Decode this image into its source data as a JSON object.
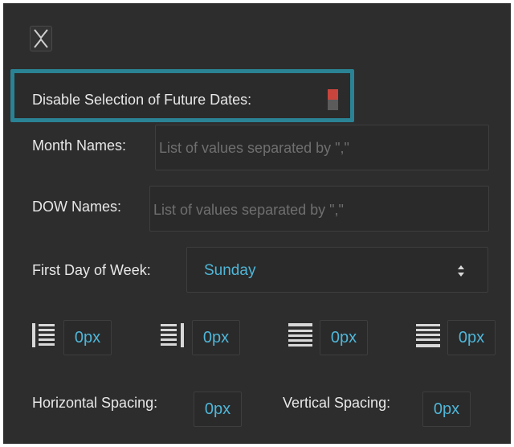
{
  "close": {
    "icon": "close-icon"
  },
  "future_dates": {
    "label": "Disable Selection of Future Dates:",
    "toggle_on": true,
    "on_color": "#c8453d"
  },
  "month_names": {
    "label": "Month Names:",
    "placeholder": "List of values separated by \",\""
  },
  "dow_names": {
    "label": "DOW Names:",
    "placeholder": "List of values separated by \",\""
  },
  "first_day": {
    "label": "First Day of Week:",
    "value": "Sunday"
  },
  "paddings": [
    {
      "icon": "align-left-icon",
      "value": "0px"
    },
    {
      "icon": "align-right-icon",
      "value": "0px"
    },
    {
      "icon": "align-top-icon",
      "value": "0px"
    },
    {
      "icon": "align-bottom-icon",
      "value": "0px"
    }
  ],
  "horizontal_spacing": {
    "label": "Horizontal Spacing:",
    "value": "0px"
  },
  "vertical_spacing": {
    "label": "Vertical Spacing:",
    "value": "0px"
  },
  "colors": {
    "panel": "#2d2d2d",
    "accent": "#4fb6d8",
    "highlight": "#2a8394"
  }
}
